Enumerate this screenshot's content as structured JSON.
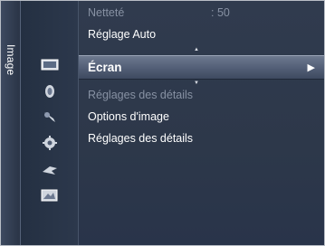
{
  "side_tab": {
    "label": "Image"
  },
  "icons": [
    {
      "name": "picture-icon"
    },
    {
      "name": "sound-icon"
    },
    {
      "name": "setup-icon"
    },
    {
      "name": "settings-gear-icon"
    },
    {
      "name": "input-icon"
    },
    {
      "name": "application-icon"
    }
  ],
  "menu": {
    "sharpness_label": "Netteté",
    "sharpness_value": ": 50",
    "auto_adjust_label": "Réglage Auto",
    "selected_label": "Écran",
    "selected_arrow": "▶",
    "detail_dim_label": "Réglages des détails",
    "picture_options_label": "Options d'image",
    "detail_label": "Réglages des détails"
  },
  "colors": {
    "panel_bg": "#2f3a4c",
    "highlight_bar": "#56627a",
    "dim_text": "#8791a3",
    "text": "#ffffff"
  }
}
